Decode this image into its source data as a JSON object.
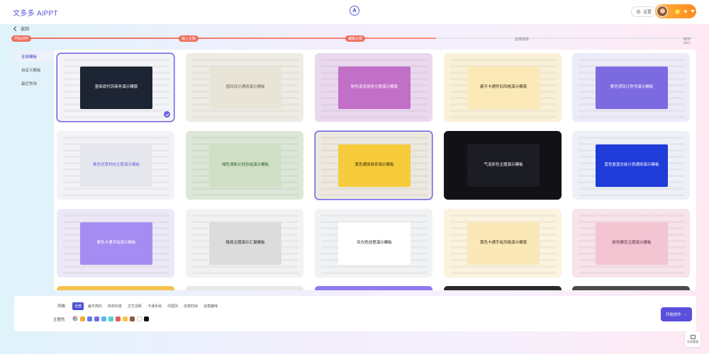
{
  "app": {
    "brand": "文多多 AiPPT"
  },
  "header": {
    "settings_label": "设置"
  },
  "nav": {
    "back_label": "返回"
  },
  "progress": {
    "fill_fraction": 0.62,
    "steps": [
      {
        "label": "开始创作",
        "state": "done"
      },
      {
        "label": "输入主题",
        "state": "done"
      },
      {
        "label": "编辑大纲",
        "state": "done"
      },
      {
        "label": "选择模板",
        "state": "todo"
      },
      {
        "label": "制作PPT",
        "state": "todo"
      }
    ]
  },
  "sidebar": {
    "items": [
      {
        "label": "全部模板",
        "active": true
      },
      {
        "label": "自定义模板",
        "active": false
      },
      {
        "label": "最近常用",
        "active": false
      }
    ]
  },
  "templates": [
    {
      "title": "墨染现代风商务演示模版",
      "bg": "#f3f4f8",
      "hero_bg": "#1d2433",
      "hero_color": "#ffffff",
      "selected": true
    },
    {
      "title": "国风设计通用演示模板",
      "bg": "#efece5",
      "hero_bg": "#e9e4d8",
      "hero_color": "#6b5e4a",
      "selected": false
    },
    {
      "title": "粉色渐变商务主题演示模版",
      "bg": "#ead8ef",
      "hero_bg": "#c26fc7",
      "hero_color": "#ffffff",
      "selected": false
    },
    {
      "title": "扁平卡通怀旧风格演示模版",
      "bg": "#faf0d8",
      "hero_bg": "#fbe9b7",
      "hero_color": "#3a2c12",
      "selected": false
    },
    {
      "title": "紫色项目计划书演示模板",
      "bg": "#ecebf8",
      "hero_bg": "#7c6ae0",
      "hero_color": "#ffffff",
      "selected": false
    },
    {
      "title": "紫色创意科技主题演示模板",
      "bg": "#f3f3f7",
      "hero_bg": "#e6e6ee",
      "hero_color": "#6a5fe0",
      "selected": false
    },
    {
      "title": "绿色清新计划总结演示模板",
      "bg": "#dde7d8",
      "hero_bg": "#cfe0c6",
      "hero_color": "#2f5a2a",
      "selected": false
    },
    {
      "title": "黄色通用商务演示模板",
      "bg": "#ede9e0",
      "hero_bg": "#f6cb3c",
      "hero_color": "#3a2a00",
      "selected": true
    },
    {
      "title": "气泡彩色主题演示模板",
      "bg": "#121216",
      "hero_bg": "#1c1c24",
      "hero_color": "#ffffff",
      "selected": false
    },
    {
      "title": "蓝色复盘总结计划通用演示模板",
      "bg": "#eef0f8",
      "hero_bg": "#1f3bd8",
      "hero_color": "#ffffff",
      "selected": false
    },
    {
      "title": "紫色卡通手绘演示模板",
      "bg": "#ece8f7",
      "hero_bg": "#a58cf2",
      "hero_color": "#ffffff",
      "selected": false
    },
    {
      "title": "极简主题演示汇报模板",
      "bg": "#f2f2f2",
      "hero_bg": "#dcdcdc",
      "hero_color": "#222222",
      "selected": false
    },
    {
      "title": "灰白色创意演示模板",
      "bg": "#f1f2f4",
      "hero_bg": "#ffffff",
      "hero_color": "#222222",
      "selected": false
    },
    {
      "title": "黄色卡通手绘风格演示模版",
      "bg": "#fbf3df",
      "hero_bg": "#fbe8b8",
      "hero_color": "#3a2c12",
      "selected": false
    },
    {
      "title": "粉色樱花主题演示模板",
      "bg": "#f7e3ea",
      "hero_bg": "#f3c4d2",
      "hero_color": "#5a2a3a",
      "selected": false
    }
  ],
  "partial_row_colors": [
    "#f3c34e",
    "#e9e9e9",
    "#8e7bf0",
    "#2a2a2a",
    "#4b4b4b"
  ],
  "filters": {
    "style_label": "风格",
    "style_options": [
      {
        "label": "全部",
        "active": true
      },
      {
        "label": "扁平简约",
        "active": false
      },
      {
        "label": "商务科技",
        "active": false
      },
      {
        "label": "文艺清新",
        "active": false
      },
      {
        "label": "卡通手绘",
        "active": false
      },
      {
        "label": "中国风",
        "active": false
      },
      {
        "label": "创意时尚",
        "active": false
      },
      {
        "label": "创意趣味",
        "active": false
      }
    ],
    "color_label": "主题色",
    "color_swatches": [
      "all",
      "#f2a93b",
      "#5b7ef0",
      "#7a68e8",
      "#59b6f0",
      "#4fd2c9",
      "#e65c5c",
      "#f2c54a",
      "#8a5a3b",
      "#ffffff",
      "#111111"
    ]
  },
  "actions": {
    "start_label": "开始创作"
  },
  "feedback": {
    "label": "在线客服"
  }
}
